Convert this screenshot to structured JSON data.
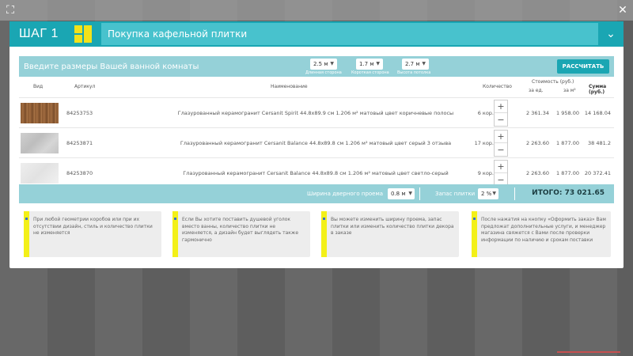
{
  "header": {
    "step": "ШАГ 1",
    "title": "Покупка кафельной плитки"
  },
  "sizes": {
    "title": "Введите размеры Вашей ванной комнаты",
    "length": {
      "value": "2.5 м",
      "label": "Длинная сторона"
    },
    "width": {
      "value": "1.7 м",
      "label": "Короткая сторона"
    },
    "height": {
      "value": "2.7 м",
      "label": "Высота потолка"
    },
    "calc_button": "РАССЧИТАТЬ"
  },
  "table": {
    "headers": {
      "view": "Вид",
      "article": "Артикул",
      "name": "Наименование",
      "qty": "Количество",
      "cost": "Стоимость (руб.)",
      "per_unit": "за ед.",
      "per_m2": "за м²",
      "sum": "Сумма (руб.)"
    },
    "rows": [
      {
        "article": "84253753",
        "name": "Глазурованный керамогранит Cersanit Spirit 44.8x89.9 см 1.206 м² матовый цвет коричневые полосы",
        "qty": "6 кор.",
        "unit": "2 361.34",
        "m2": "1 958.00",
        "sum": "14 168.04"
      },
      {
        "article": "84253871",
        "name": "Глазурованный керамогранит Cersanit Balance 44.8x89.8 см 1.206 м² матовый цвет серый 3 отзыва",
        "qty": "17 кор.",
        "unit": "2 263.60",
        "m2": "1 877.00",
        "sum": "38 481.2"
      },
      {
        "article": "84253870",
        "name": "Глазурованный керамогранит Cersanit Balance 44.8x89.8 см 1.206 м² матовый цвет светло-серый",
        "qty": "9 кор.",
        "unit": "2 263.60",
        "m2": "1 877.00",
        "sum": "20 372.41"
      }
    ]
  },
  "footer": {
    "door_label": "Ширина дверного проема",
    "door_value": "0.8 м",
    "reserve_label": "Запас плитки",
    "reserve_value": "2 %",
    "total": "ИТОГО: 73 021.65"
  },
  "notes": [
    "При любой геометрии коробов или при их отсутствии дизайн, стиль и количество плитки не изменяется",
    "Если Вы хотите поставить душевой уголок вместо ванны, количество плитки не изменяется, а дизайн будет выглядеть также гармонично",
    "Вы можете изменить ширину проема, запас плитки или изменить количество плитки декора в заказе",
    "После нажатия на кнопку «Оформить заказ» Вам предложат дополнительные услуги, и менеджер магазина свяжется с Вами после проверки информации по наличию и срокам поставки"
  ],
  "colors": {
    "accent": "#1aa6b3",
    "accent_light": "#95d1d8",
    "note_bar": "#f3f018"
  },
  "icons": {
    "fullscreen": "fullscreen-icon",
    "close": "close-icon",
    "chevron": "chevron-down-icon",
    "plus": "plus-icon",
    "minus": "minus-icon"
  }
}
